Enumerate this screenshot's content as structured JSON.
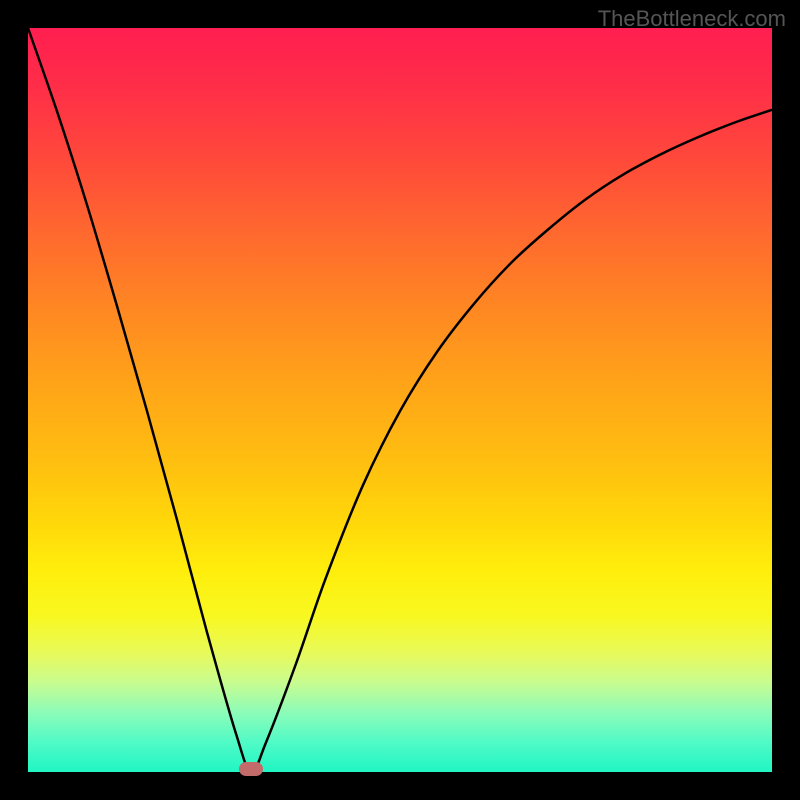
{
  "watermark": "TheBottleneck.com",
  "chart_data": {
    "type": "line",
    "title": "",
    "xlabel": "",
    "ylabel": "",
    "xlim": [
      0,
      1
    ],
    "ylim": [
      0,
      100
    ],
    "background_gradient": {
      "top": "#FF1E50",
      "mid": "#FFD60A",
      "bottom": "#20F6C4"
    },
    "series": [
      {
        "name": "bottleneck-curve",
        "x": [
          0.0,
          0.04,
          0.08,
          0.12,
          0.16,
          0.2,
          0.24,
          0.28,
          0.3,
          0.32,
          0.36,
          0.4,
          0.45,
          0.5,
          0.55,
          0.6,
          0.65,
          0.7,
          0.75,
          0.8,
          0.85,
          0.9,
          0.95,
          1.0
        ],
        "y": [
          100,
          88.5,
          76,
          62.5,
          48.5,
          34,
          19,
          5,
          0,
          4,
          14.5,
          26,
          38.5,
          48.5,
          56.5,
          63,
          68.5,
          73,
          77,
          80.3,
          83,
          85.3,
          87.3,
          89
        ]
      }
    ],
    "marker": {
      "x": 0.3,
      "y": 0,
      "color": "#C36A6A"
    }
  }
}
